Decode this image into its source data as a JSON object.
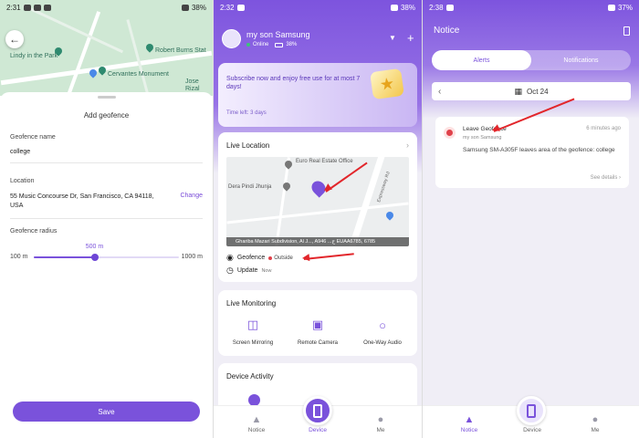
{
  "panel1": {
    "status": {
      "time": "2:31",
      "battery": "38%"
    },
    "map": {
      "labels": [
        "Lindy in the Park",
        "Robert Burns Stat",
        "Cervantes Monument",
        "Jose Rizal"
      ]
    },
    "sheet_title": "Add geofence",
    "name_label": "Geofence name",
    "name_value": "college",
    "location_label": "Location",
    "location_value": "55 Music Concourse Dr, San Francisco, CA 94118, USA",
    "change_label": "Change",
    "radius_label": "Geofence radius",
    "radius_value": "500 m",
    "radius_fraction": 0.42,
    "radius_min": "100 m",
    "radius_max": "1000 m",
    "save_label": "Save"
  },
  "panel2": {
    "status": {
      "time": "2:32",
      "battery": "38%"
    },
    "user": {
      "name": "my son Samsung",
      "status": "Online",
      "battery": "38%"
    },
    "promo": {
      "text": "Subscribe now and enjoy free use for at most 7 days!",
      "timeleft": "Time left: 3 days"
    },
    "live_location": {
      "title": "Live Location",
      "map_labels": [
        "Euro Real Estate Office",
        "Dera Pindi Jhunja",
        "Expressway Rd"
      ],
      "address": "Ghariba Mazari Subdivision, Al J..., A946 ...ج EUAA6785, 6785",
      "geofence_label": "Geofence",
      "geofence_status": "Outside",
      "update_label": "Update",
      "update_time": "Now"
    },
    "monitoring": {
      "title": "Live Monitoring",
      "items": [
        {
          "label": "Screen Mirroring",
          "icon": "screen-mirroring-icon"
        },
        {
          "label": "Remote Camera",
          "icon": "camera-icon"
        },
        {
          "label": "One-Way Audio",
          "icon": "headphones-icon"
        }
      ]
    },
    "activity_title": "Device Activity",
    "nav": {
      "notice": "Notice",
      "device": "Device",
      "me": "Me"
    }
  },
  "panel3": {
    "status": {
      "time": "2:38",
      "battery": "37%"
    },
    "title": "Notice",
    "tabs": {
      "alerts": "Alerts",
      "notifications": "Notifications"
    },
    "date": "Oct 24",
    "notification": {
      "title": "Leave Geofence",
      "time": "6 minutes ago",
      "device": "my son Samsung",
      "body": "Samsung SM-A305F leaves area of the geofence: college",
      "details": "See details"
    },
    "nav": {
      "notice": "Notice",
      "device": "Device",
      "me": "Me"
    }
  },
  "colors": {
    "accent": "#7a52db",
    "alert": "#e0414a",
    "online": "#3cc37a"
  }
}
